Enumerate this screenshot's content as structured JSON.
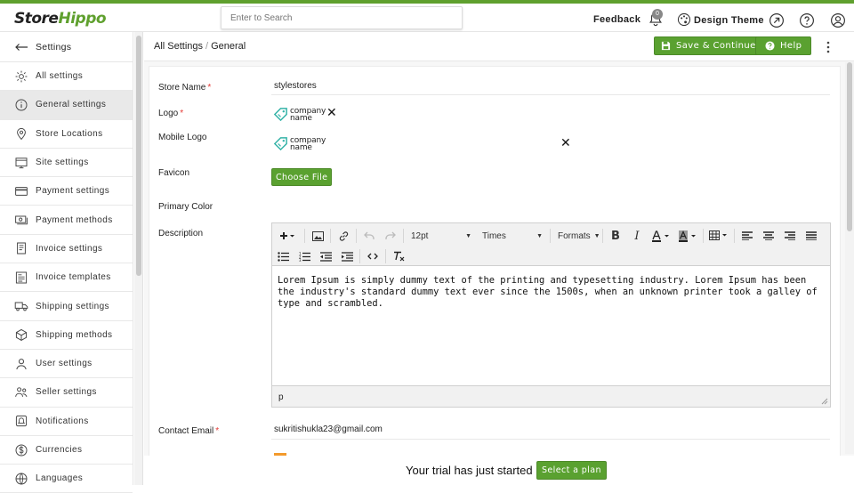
{
  "header": {
    "logo_part1": "Store",
    "logo_part2": "Hippo",
    "search_placeholder": "Enter to Search",
    "feedback": "Feedback",
    "notification_count": "0",
    "design_theme": "Design Theme"
  },
  "sidebar": {
    "back_label": "Settings",
    "items": [
      {
        "label": "All settings",
        "icon": "gear-icon"
      },
      {
        "label": "General settings",
        "icon": "info-icon",
        "active": true
      },
      {
        "label": "Store Locations",
        "icon": "location-pin-icon"
      },
      {
        "label": "Site settings",
        "icon": "site-icon"
      },
      {
        "label": "Payment settings",
        "icon": "card-icon"
      },
      {
        "label": "Payment methods",
        "icon": "cash-icon"
      },
      {
        "label": "Invoice settings",
        "icon": "invoice-icon"
      },
      {
        "label": "Invoice templates",
        "icon": "template-icon"
      },
      {
        "label": "Shipping settings",
        "icon": "truck-icon"
      },
      {
        "label": "Shipping methods",
        "icon": "box-icon"
      },
      {
        "label": "User settings",
        "icon": "user-icon"
      },
      {
        "label": "Seller settings",
        "icon": "seller-icon"
      },
      {
        "label": "Notifications",
        "icon": "notification-icon"
      },
      {
        "label": "Currencies",
        "icon": "currency-icon"
      },
      {
        "label": "Languages",
        "icon": "language-icon"
      }
    ]
  },
  "breadcrumb": {
    "root": "All Settings",
    "sep": "/",
    "current": "General"
  },
  "actions": {
    "save": "Save & Continue",
    "help": "Help"
  },
  "form": {
    "store_name_label": "Store Name",
    "store_name_value": "stylestores",
    "logo_label": "Logo",
    "logo_text_1": "company",
    "logo_text_2": "name",
    "mobile_logo_label": "Mobile Logo",
    "favicon_label": "Favicon",
    "choose_file": "Choose File",
    "primary_color_label": "Primary Color",
    "description_label": "Description",
    "font_size": "12pt",
    "font_family": "Times",
    "formats": "Formats",
    "description_text": "Lorem Ipsum is simply dummy text of the printing and typesetting industry. Lorem Ipsum has been the industry's standard dummy text ever since the 1500s, when an unknown printer took a galley of type and scrambled.",
    "status_path": "p",
    "contact_email_label": "Contact Email",
    "contact_email_value": "sukritishukla23@gmail.com",
    "required_mark": "*"
  },
  "trial": {
    "text": "Your trial has just started",
    "button": "Select a plan"
  },
  "colors": {
    "brand": "#5aa130",
    "required": "#e53935"
  }
}
